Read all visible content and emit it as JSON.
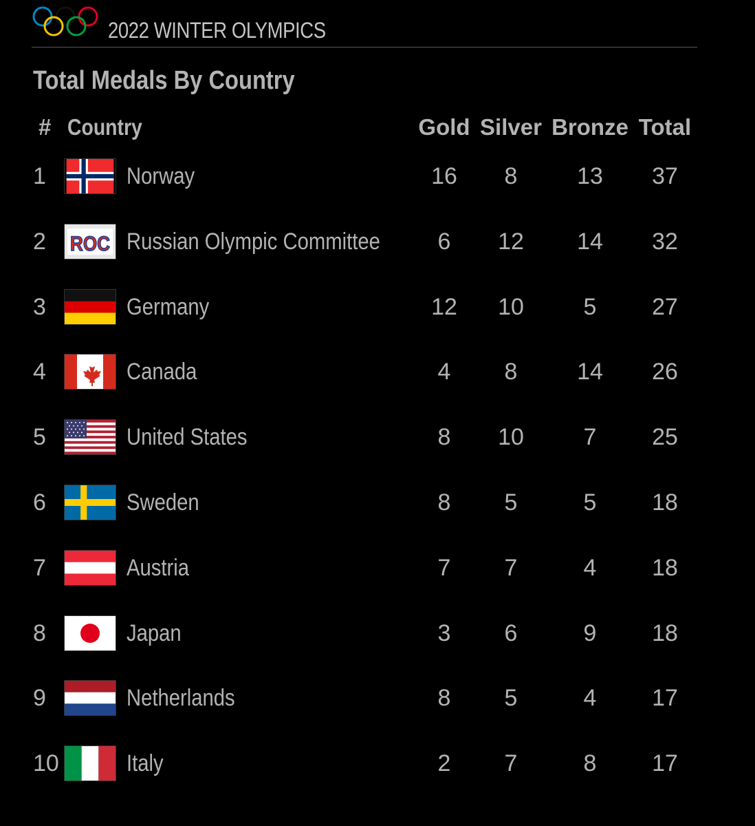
{
  "header": {
    "title": "2022 WINTER OLYMPICS",
    "logo_icon": "olympic-rings-icon"
  },
  "section_title": "Total Medals By Country",
  "columns": {
    "rank": "#",
    "country": "Country",
    "gold": "Gold",
    "silver": "Silver",
    "bronze": "Bronze",
    "total": "Total"
  },
  "rows": [
    {
      "rank": "1",
      "flag_icon": "norway-flag-icon",
      "country": "Norway",
      "gold": "16",
      "silver": "8",
      "bronze": "13",
      "total": "37"
    },
    {
      "rank": "2",
      "flag_icon": "roc-flag-icon",
      "flag_text": "ROC",
      "country": "Russian Olympic Committee",
      "gold": "6",
      "silver": "12",
      "bronze": "14",
      "total": "32"
    },
    {
      "rank": "3",
      "flag_icon": "germany-flag-icon",
      "country": "Germany",
      "gold": "12",
      "silver": "10",
      "bronze": "5",
      "total": "27"
    },
    {
      "rank": "4",
      "flag_icon": "canada-flag-icon",
      "country": "Canada",
      "gold": "4",
      "silver": "8",
      "bronze": "14",
      "total": "26"
    },
    {
      "rank": "5",
      "flag_icon": "usa-flag-icon",
      "country": "United States",
      "gold": "8",
      "silver": "10",
      "bronze": "7",
      "total": "25"
    },
    {
      "rank": "6",
      "flag_icon": "sweden-flag-icon",
      "country": "Sweden",
      "gold": "8",
      "silver": "5",
      "bronze": "5",
      "total": "18"
    },
    {
      "rank": "7",
      "flag_icon": "austria-flag-icon",
      "country": "Austria",
      "gold": "7",
      "silver": "7",
      "bronze": "4",
      "total": "18"
    },
    {
      "rank": "8",
      "flag_icon": "japan-flag-icon",
      "country": "Japan",
      "gold": "3",
      "silver": "6",
      "bronze": "9",
      "total": "18"
    },
    {
      "rank": "9",
      "flag_icon": "netherlands-flag-icon",
      "country": "Netherlands",
      "gold": "8",
      "silver": "5",
      "bronze": "4",
      "total": "17"
    },
    {
      "rank": "10",
      "flag_icon": "italy-flag-icon",
      "country": "Italy",
      "gold": "2",
      "silver": "7",
      "bronze": "8",
      "total": "17"
    }
  ]
}
